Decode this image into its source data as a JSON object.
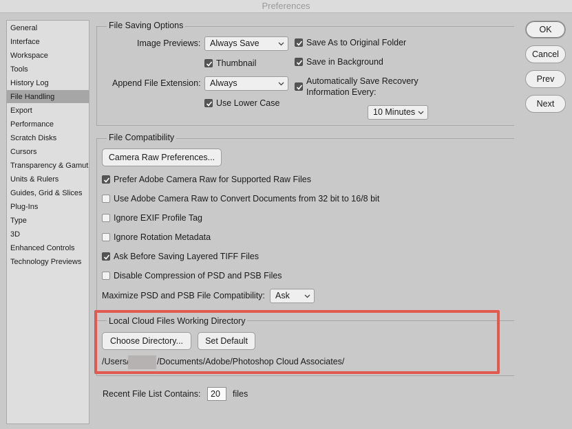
{
  "window": {
    "title": "Preferences"
  },
  "sidebar": {
    "items": [
      {
        "label": "General"
      },
      {
        "label": "Interface"
      },
      {
        "label": "Workspace"
      },
      {
        "label": "Tools"
      },
      {
        "label": "History Log"
      },
      {
        "label": "File Handling",
        "active": true
      },
      {
        "label": "Export"
      },
      {
        "label": "Performance"
      },
      {
        "label": "Scratch Disks"
      },
      {
        "label": "Cursors"
      },
      {
        "label": "Transparency & Gamut"
      },
      {
        "label": "Units & Rulers"
      },
      {
        "label": "Guides, Grid & Slices"
      },
      {
        "label": "Plug-Ins"
      },
      {
        "label": "Type"
      },
      {
        "label": "3D"
      },
      {
        "label": "Enhanced Controls"
      },
      {
        "label": "Technology Previews"
      }
    ]
  },
  "actions": {
    "ok": "OK",
    "cancel": "Cancel",
    "prev": "Prev",
    "next": "Next"
  },
  "file_saving": {
    "title": "File Saving Options",
    "image_previews_label": "Image Previews:",
    "image_previews_value": "Always Save",
    "thumbnail_label": "Thumbnail",
    "thumbnail_checked": true,
    "append_ext_label": "Append File Extension:",
    "append_ext_value": "Always",
    "lower_case_label": "Use Lower Case",
    "lower_case_checked": true,
    "save_as_original_label": "Save As to Original Folder",
    "save_as_original_checked": true,
    "save_background_label": "Save in Background",
    "save_background_checked": true,
    "auto_save_label_1": "Automatically Save Recovery",
    "auto_save_label_2": "Information Every:",
    "auto_save_checked": true,
    "auto_save_interval": "10 Minutes"
  },
  "file_compat": {
    "title": "File Compatibility",
    "camera_raw_button": "Camera Raw Preferences...",
    "options": [
      {
        "label": "Prefer Adobe Camera Raw for Supported Raw Files",
        "checked": true
      },
      {
        "label": "Use Adobe Camera Raw to Convert Documents from 32 bit to 16/8 bit",
        "checked": false
      },
      {
        "label": "Ignore EXIF Profile Tag",
        "checked": false
      },
      {
        "label": "Ignore Rotation Metadata",
        "checked": false
      },
      {
        "label": "Ask Before Saving Layered TIFF Files",
        "checked": true
      },
      {
        "label": "Disable Compression of PSD and PSB Files",
        "checked": false
      }
    ],
    "maximize_label": "Maximize PSD and PSB File Compatibility:",
    "maximize_value": "Ask"
  },
  "cloud": {
    "title": "Local Cloud Files Working Directory",
    "choose_button": "Choose Directory...",
    "default_button": "Set Default",
    "path_prefix": "/Users/",
    "path_suffix": "/Documents/Adobe/Photoshop Cloud Associates/"
  },
  "recent": {
    "label": "Recent File List Contains:",
    "value": "20",
    "unit": "files"
  },
  "colors": {
    "accent_highlight": "#e25a4f",
    "active_sidebar": "#a6a6a6",
    "background": "#c9c9c9"
  }
}
